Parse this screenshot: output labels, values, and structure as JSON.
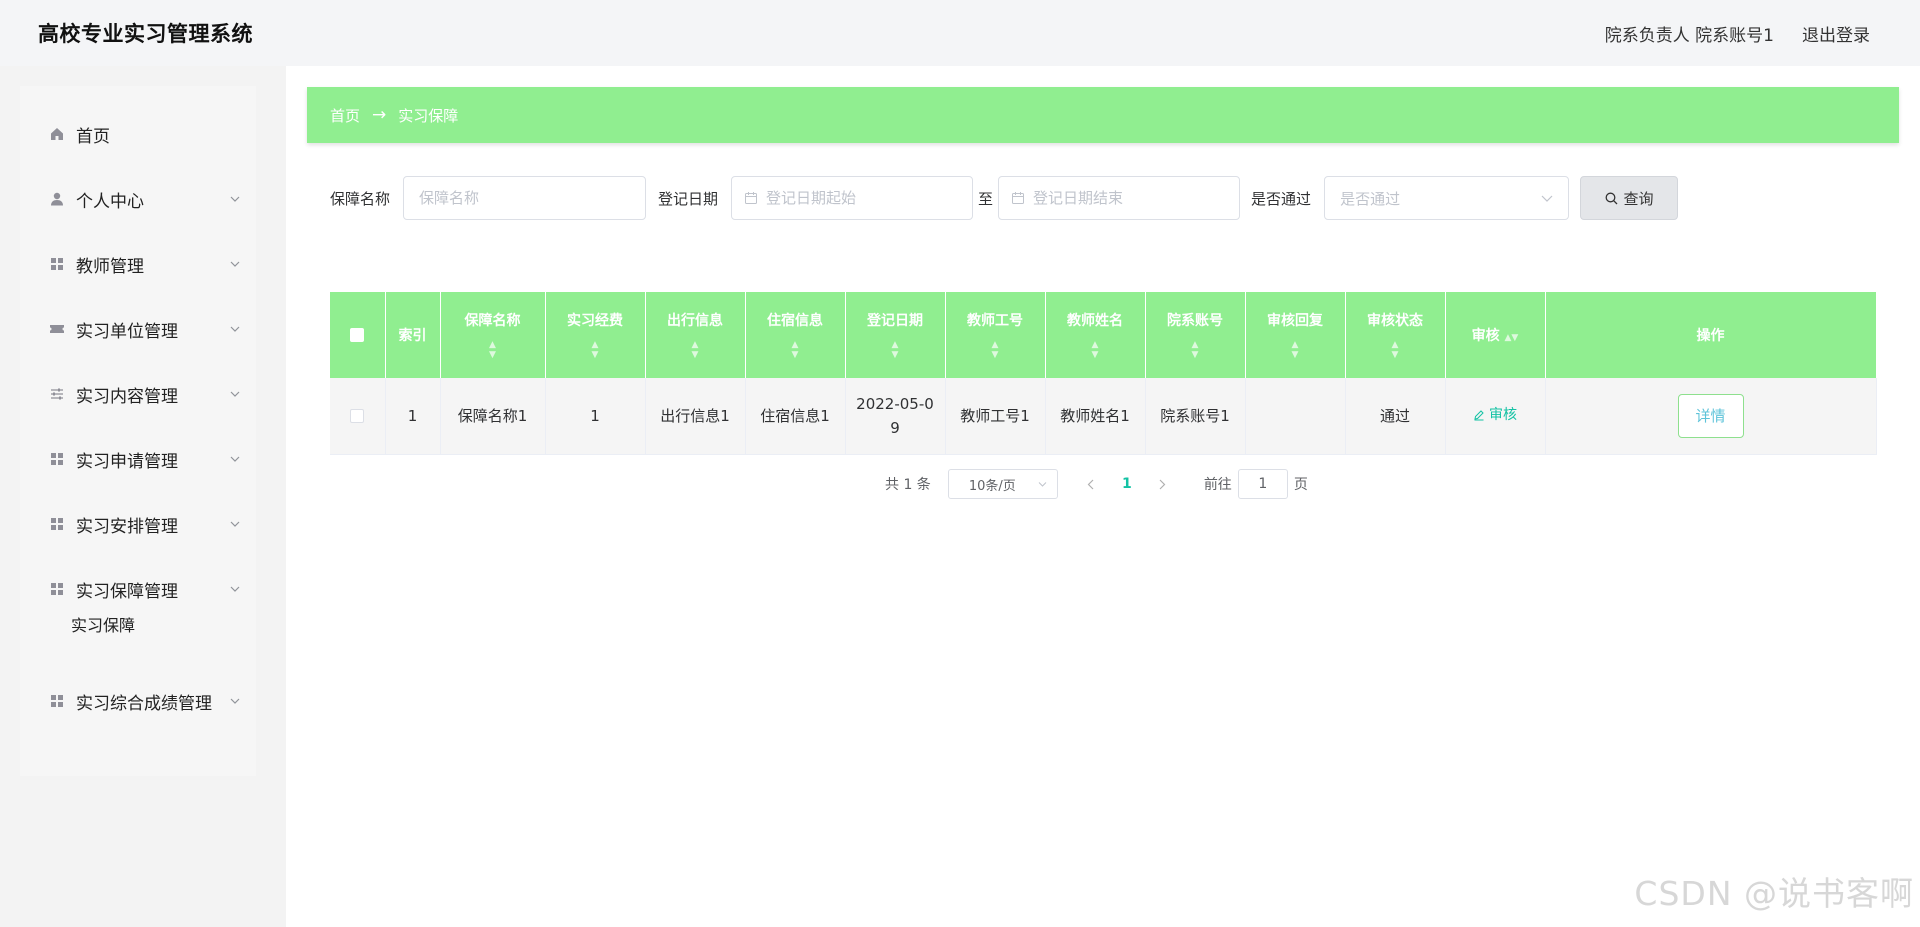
{
  "header": {
    "app_title": "高校专业实习管理系统",
    "user_info": "院系负责人 院系账号1",
    "logout": "退出登录"
  },
  "sidebar": {
    "items": [
      {
        "label": "首页",
        "icon": "home-icon"
      },
      {
        "label": "个人中心",
        "icon": "user-icon"
      },
      {
        "label": "教师管理",
        "icon": "grid-icon"
      },
      {
        "label": "实习单位管理",
        "icon": "ticket-icon"
      },
      {
        "label": "实习内容管理",
        "icon": "sliders-icon"
      },
      {
        "label": "实习申请管理",
        "icon": "grid-icon"
      },
      {
        "label": "实习安排管理",
        "icon": "grid-icon"
      },
      {
        "label": "实习保障管理",
        "icon": "grid-icon"
      },
      {
        "label": "实习综合成绩管理",
        "icon": "grid-icon"
      }
    ],
    "sub_items": [
      {
        "label": "实习保障"
      }
    ]
  },
  "breadcrumb": {
    "home": "首页",
    "separator": "→",
    "current": "实习保障"
  },
  "search": {
    "name_label": "保障名称",
    "name_placeholder": "保障名称",
    "date_label": "登记日期",
    "date_start_placeholder": "登记日期起始",
    "date_to": "至",
    "date_end_placeholder": "登记日期结束",
    "pass_label": "是否通过",
    "pass_placeholder": "是否通过",
    "button": "查询"
  },
  "table": {
    "headers": [
      "索引",
      "保障名称",
      "实习经费",
      "出行信息",
      "住宿信息",
      "登记日期",
      "教师工号",
      "教师姓名",
      "院系账号",
      "审核回复",
      "审核状态",
      "审核",
      "操作"
    ],
    "rows": [
      {
        "index": "1",
        "name": "保障名称1",
        "funds": "1",
        "travel": "出行信息1",
        "lodging": "住宿信息1",
        "date": "2022-05-09",
        "teacher_id": "教师工号1",
        "teacher_name": "教师姓名1",
        "dept_account": "院系账号1",
        "reply": "",
        "status": "通过",
        "audit_link": "审核",
        "detail": "详情"
      }
    ]
  },
  "pagination": {
    "total": "共 1 条",
    "page_size": "10条/页",
    "current_page": "1",
    "goto_label": "前往",
    "goto_value": "1",
    "page_unit": "页"
  },
  "watermark": "CSDN @说书客啊",
  "colors": {
    "accent_green": "#90ee90",
    "link_teal": "#13c2a4"
  }
}
